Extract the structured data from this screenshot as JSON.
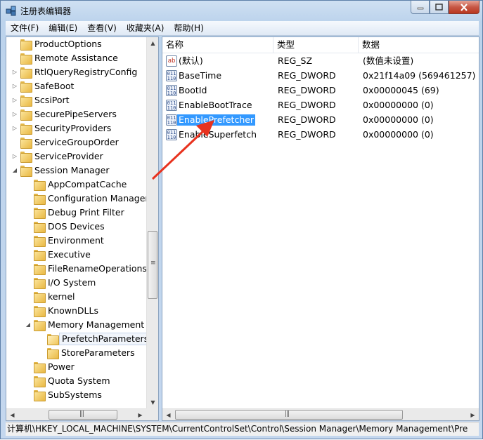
{
  "window": {
    "title": "注册表编辑器"
  },
  "menu": [
    {
      "label": "文件(F)"
    },
    {
      "label": "编辑(E)"
    },
    {
      "label": "查看(V)"
    },
    {
      "label": "收藏夹(A)"
    },
    {
      "label": "帮助(H)"
    }
  ],
  "tree": [
    {
      "label": "ProductOptions",
      "depth": 0,
      "expander": ""
    },
    {
      "label": "Remote Assistance",
      "depth": 0,
      "expander": ""
    },
    {
      "label": "RtlQueryRegistryConfig",
      "depth": 0,
      "expander": "▷"
    },
    {
      "label": "SafeBoot",
      "depth": 0,
      "expander": "▷"
    },
    {
      "label": "ScsiPort",
      "depth": 0,
      "expander": "▷"
    },
    {
      "label": "SecurePipeServers",
      "depth": 0,
      "expander": "▷"
    },
    {
      "label": "SecurityProviders",
      "depth": 0,
      "expander": "▷"
    },
    {
      "label": "ServiceGroupOrder",
      "depth": 0,
      "expander": ""
    },
    {
      "label": "ServiceProvider",
      "depth": 0,
      "expander": "▷"
    },
    {
      "label": "Session Manager",
      "depth": 0,
      "expander": "◢"
    },
    {
      "label": "AppCompatCache",
      "depth": 1,
      "expander": ""
    },
    {
      "label": "Configuration Manager",
      "depth": 1,
      "expander": ""
    },
    {
      "label": "Debug Print Filter",
      "depth": 1,
      "expander": ""
    },
    {
      "label": "DOS Devices",
      "depth": 1,
      "expander": ""
    },
    {
      "label": "Environment",
      "depth": 1,
      "expander": ""
    },
    {
      "label": "Executive",
      "depth": 1,
      "expander": ""
    },
    {
      "label": "FileRenameOperations",
      "depth": 1,
      "expander": ""
    },
    {
      "label": "I/O System",
      "depth": 1,
      "expander": ""
    },
    {
      "label": "kernel",
      "depth": 1,
      "expander": ""
    },
    {
      "label": "KnownDLLs",
      "depth": 1,
      "expander": ""
    },
    {
      "label": "Memory Management",
      "depth": 1,
      "expander": "◢"
    },
    {
      "label": "PrefetchParameters",
      "depth": 2,
      "expander": "",
      "selected": true
    },
    {
      "label": "StoreParameters",
      "depth": 2,
      "expander": ""
    },
    {
      "label": "Power",
      "depth": 1,
      "expander": ""
    },
    {
      "label": "Quota System",
      "depth": 1,
      "expander": ""
    },
    {
      "label": "SubSystems",
      "depth": 1,
      "expander": ""
    }
  ],
  "list": {
    "columns": [
      "名称",
      "类型",
      "数据"
    ],
    "rows": [
      {
        "name": "(默认)",
        "type": "REG_SZ",
        "data": "(数值未设置)",
        "icon": "string-value-icon"
      },
      {
        "name": "BaseTime",
        "type": "REG_DWORD",
        "data": "0x21f14a09 (569461257)",
        "icon": "dword-value-icon"
      },
      {
        "name": "BootId",
        "type": "REG_DWORD",
        "data": "0x00000045 (69)",
        "icon": "dword-value-icon"
      },
      {
        "name": "EnableBootTrace",
        "type": "REG_DWORD",
        "data": "0x00000000 (0)",
        "icon": "dword-value-icon"
      },
      {
        "name": "EnablePrefetcher",
        "type": "REG_DWORD",
        "data": "0x00000000 (0)",
        "icon": "dword-value-icon",
        "selected": true
      },
      {
        "name": "EnableSuperfetch",
        "type": "REG_DWORD",
        "data": "0x00000000 (0)",
        "icon": "dword-value-icon"
      }
    ]
  },
  "status": {
    "path": "计算机\\HKEY_LOCAL_MACHINE\\SYSTEM\\CurrentControlSet\\Control\\Session Manager\\Memory Management\\Pre"
  },
  "colors": {
    "selection": "#3399ff",
    "annotation_arrow": "#e8321e"
  }
}
